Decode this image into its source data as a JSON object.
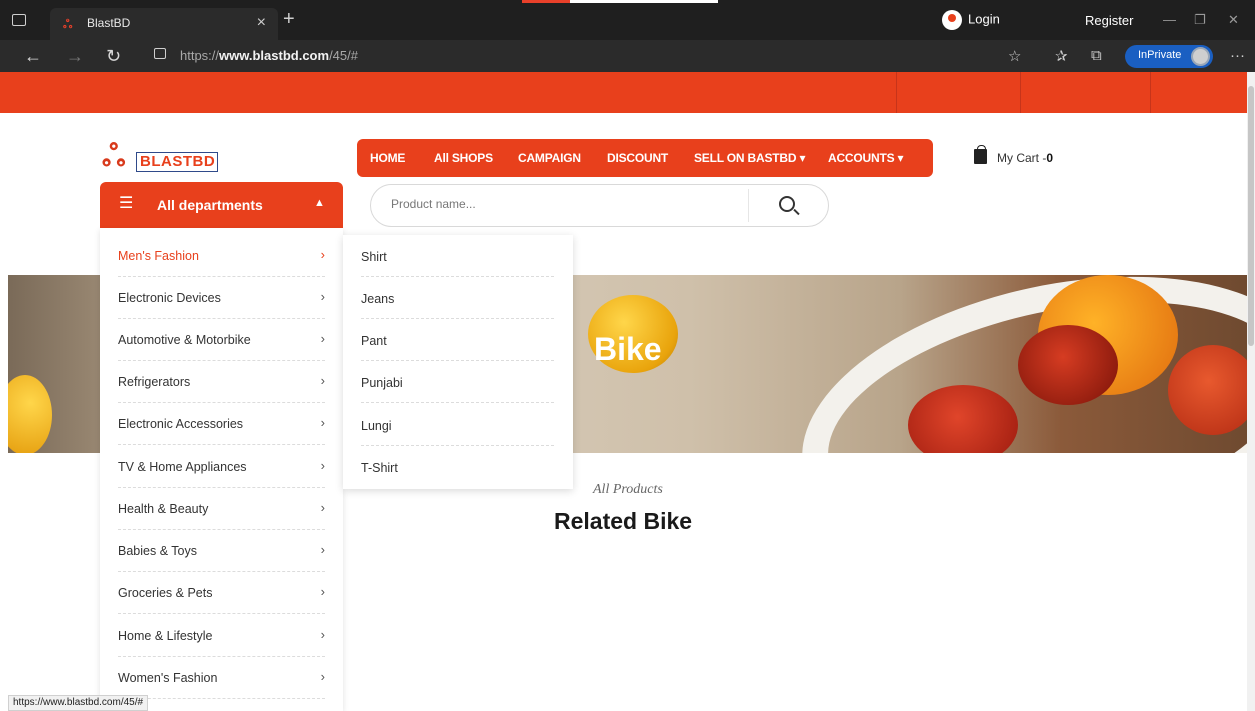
{
  "browser": {
    "tab_title": "BlastBD",
    "url_prefix": "https://",
    "url_domain": "www.blastbd.com",
    "url_path": "/45/#",
    "inprivate_label": "InPrivate",
    "status_url": "https://www.blastbd.com/45/#"
  },
  "topbar": {
    "login": "Login",
    "register": "Register"
  },
  "logo": {
    "text": "BLASTBD"
  },
  "nav": {
    "items": [
      "HOME",
      "All SHOPS",
      "CAMPAIGN",
      "DISCOUNT",
      "SELL ON BASTBD ▾",
      "ACCOUNTS ▾"
    ]
  },
  "cart": {
    "label": "My Cart -",
    "count": "0"
  },
  "departments": {
    "title": "All departments",
    "items": [
      "Men's Fashion",
      "Electronic Devices",
      "Automotive & Motorbike",
      "Refrigerators",
      "Electronic Accessories",
      "TV & Home Appliances",
      "Health & Beauty",
      "Babies & Toys",
      "Groceries & Pets",
      "Home & Lifestyle",
      "Women's Fashion"
    ]
  },
  "submenu": {
    "items": [
      "Shirt",
      "Jeans",
      "Pant",
      "Punjabi",
      "Lungi",
      "T-Shirt"
    ]
  },
  "search": {
    "placeholder": "Product name..."
  },
  "banner": {
    "title": "Bike"
  },
  "section": {
    "subtitle": "All Products",
    "title": "Related Bike"
  },
  "colors": {
    "brand": "#e8401c",
    "browser_dark": "#1f1f1f",
    "inprivate": "#1a5fc2"
  }
}
